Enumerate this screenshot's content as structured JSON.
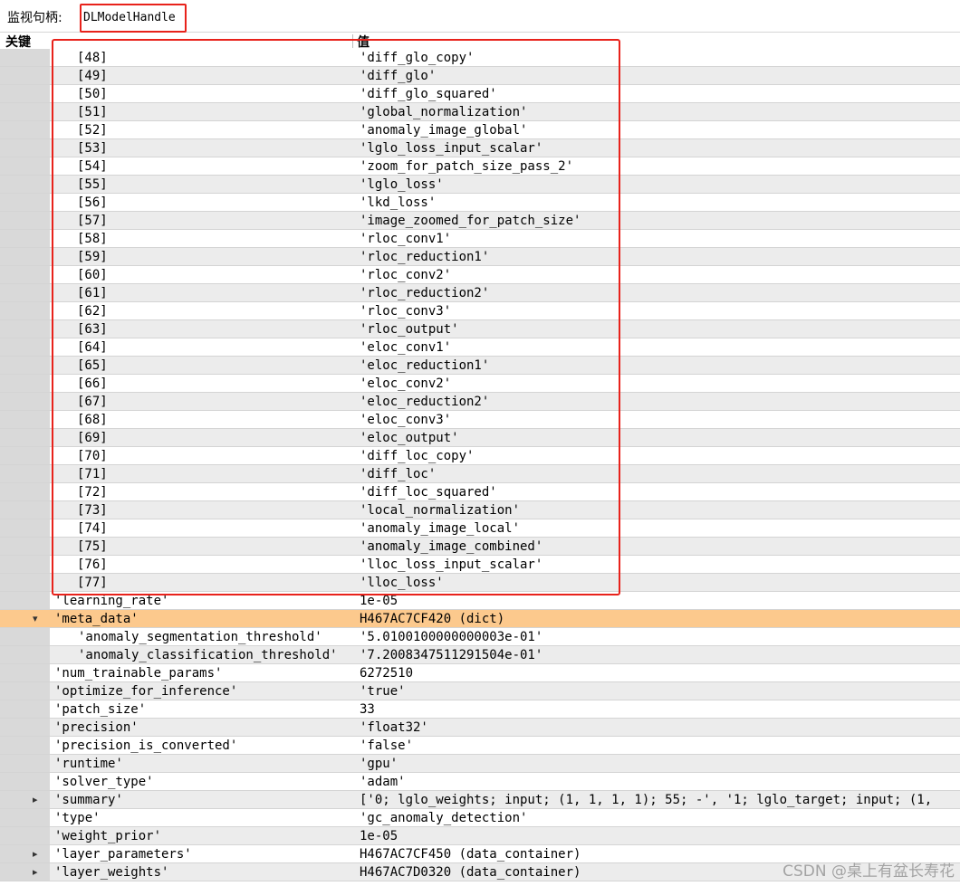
{
  "topbar": {
    "label": "监视句柄:",
    "handle": "DLModelHandle"
  },
  "header": {
    "key": "关键",
    "value": "值"
  },
  "rows": [
    {
      "key": "[48]",
      "value": "'diff_glo_copy'",
      "level": 2
    },
    {
      "key": "[49]",
      "value": "'diff_glo'",
      "level": 2
    },
    {
      "key": "[50]",
      "value": "'diff_glo_squared'",
      "level": 2
    },
    {
      "key": "[51]",
      "value": "'global_normalization'",
      "level": 2
    },
    {
      "key": "[52]",
      "value": "'anomaly_image_global'",
      "level": 2
    },
    {
      "key": "[53]",
      "value": "'lglo_loss_input_scalar'",
      "level": 2
    },
    {
      "key": "[54]",
      "value": "'zoom_for_patch_size_pass_2'",
      "level": 2
    },
    {
      "key": "[55]",
      "value": "'lglo_loss'",
      "level": 2
    },
    {
      "key": "[56]",
      "value": "'lkd_loss'",
      "level": 2
    },
    {
      "key": "[57]",
      "value": "'image_zoomed_for_patch_size'",
      "level": 2
    },
    {
      "key": "[58]",
      "value": "'rloc_conv1'",
      "level": 2
    },
    {
      "key": "[59]",
      "value": "'rloc_reduction1'",
      "level": 2
    },
    {
      "key": "[60]",
      "value": "'rloc_conv2'",
      "level": 2
    },
    {
      "key": "[61]",
      "value": "'rloc_reduction2'",
      "level": 2
    },
    {
      "key": "[62]",
      "value": "'rloc_conv3'",
      "level": 2
    },
    {
      "key": "[63]",
      "value": "'rloc_output'",
      "level": 2
    },
    {
      "key": "[64]",
      "value": "'eloc_conv1'",
      "level": 2
    },
    {
      "key": "[65]",
      "value": "'eloc_reduction1'",
      "level": 2
    },
    {
      "key": "[66]",
      "value": "'eloc_conv2'",
      "level": 2
    },
    {
      "key": "[67]",
      "value": "'eloc_reduction2'",
      "level": 2
    },
    {
      "key": "[68]",
      "value": "'eloc_conv3'",
      "level": 2
    },
    {
      "key": "[69]",
      "value": "'eloc_output'",
      "level": 2
    },
    {
      "key": "[70]",
      "value": "'diff_loc_copy'",
      "level": 2
    },
    {
      "key": "[71]",
      "value": "'diff_loc'",
      "level": 2
    },
    {
      "key": "[72]",
      "value": "'diff_loc_squared'",
      "level": 2
    },
    {
      "key": "[73]",
      "value": "'local_normalization'",
      "level": 2
    },
    {
      "key": "[74]",
      "value": "'anomaly_image_local'",
      "level": 2
    },
    {
      "key": "[75]",
      "value": "'anomaly_image_combined'",
      "level": 2
    },
    {
      "key": "[76]",
      "value": "'lloc_loss_input_scalar'",
      "level": 2
    },
    {
      "key": "[77]",
      "value": "'lloc_loss'",
      "level": 2
    },
    {
      "key": "'learning_rate'",
      "value": "1e-05",
      "level": 1
    },
    {
      "key": "'meta_data'",
      "value": "H467AC7CF420 (dict)",
      "level": 1,
      "toggle": "expanded",
      "highlight": true
    },
    {
      "key": "'anomaly_segmentation_threshold'",
      "value": "'5.0100100000000003e-01'",
      "level": 2
    },
    {
      "key": "'anomaly_classification_threshold'",
      "value": "'7.2008347511291504e-01'",
      "level": 2
    },
    {
      "key": "'num_trainable_params'",
      "value": "6272510",
      "level": 1
    },
    {
      "key": "'optimize_for_inference'",
      "value": "'true'",
      "level": 1
    },
    {
      "key": "'patch_size'",
      "value": "33",
      "level": 1
    },
    {
      "key": "'precision'",
      "value": "'float32'",
      "level": 1
    },
    {
      "key": "'precision_is_converted'",
      "value": "'false'",
      "level": 1
    },
    {
      "key": "'runtime'",
      "value": "'gpu'",
      "level": 1
    },
    {
      "key": "'solver_type'",
      "value": "'adam'",
      "level": 1
    },
    {
      "key": "'summary'",
      "value": "['0; lglo_weights; input; (1, 1, 1, 1); 55; -', '1; lglo_target; input; (1,",
      "level": 1,
      "toggle": "collapsed"
    },
    {
      "key": "'type'",
      "value": "'gc_anomaly_detection'",
      "level": 1
    },
    {
      "key": "'weight_prior'",
      "value": "1e-05",
      "level": 1
    },
    {
      "key": "'layer_parameters'",
      "value": "H467AC7CF450 (data_container)",
      "level": 1,
      "toggle": "collapsed"
    },
    {
      "key": "'layer_weights'",
      "value": "H467AC7D0320 (data_container)",
      "level": 1,
      "toggle": "collapsed"
    }
  ],
  "watermark": "CSDN @桌上有盆长寿花",
  "colors": {
    "highlight_row": "#fcc98d",
    "annotation_box": "#e8221b"
  }
}
